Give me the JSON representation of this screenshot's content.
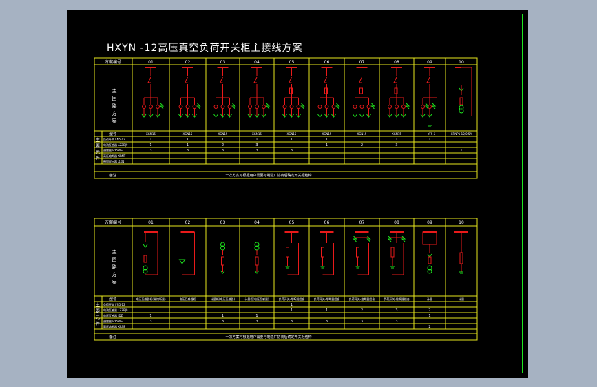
{
  "drawing": {
    "title": "HXYN -12高压真空负荷开关柜主接线方案",
    "colors": {
      "background": "#000000",
      "frame": "#1ee51e",
      "grid": "#e6e61e",
      "busbar": "#e81a1a",
      "device": "#1ee51e",
      "text": "#ffffff"
    }
  },
  "upper_table": {
    "header_label": "方案编号",
    "schemes": [
      "01",
      "02",
      "03",
      "04",
      "05",
      "06",
      "07",
      "08",
      "09",
      "10"
    ],
    "diagram_label": "主回路方案",
    "type_label": "型号",
    "types": [
      "XGN15",
      "XGN15",
      "XGN15",
      "XGN15",
      "XGN15",
      "XGN15",
      "XGN15",
      "XGN15",
      "一 YFS 5",
      "XRNP1-12/0.5A"
    ],
    "components_label": "主要元件",
    "component_rows": [
      {
        "label": "负荷开关 FN5-12",
        "values": [
          "1",
          "1",
          "1",
          "1",
          "1",
          "1",
          "1",
          "1",
          "1",
          ""
        ]
      },
      {
        "label": "电流互感器 LZZBJ9",
        "values": [
          "1",
          "1",
          "2",
          "3",
          "",
          "1",
          "2",
          "3",
          "",
          ""
        ]
      },
      {
        "label": "避雷器 HY5WS",
        "values": [
          "3",
          "3",
          "3",
          "3",
          "3",
          "",
          "",
          "",
          "",
          "1"
        ]
      },
      {
        "label": "高压熔断器 XRNT",
        "values": [
          "",
          "",
          "",
          "",
          "",
          "",
          "",
          "",
          "",
          ""
        ]
      },
      {
        "label": "带电显示器 DXN",
        "values": [
          "",
          "",
          "",
          "",
          "",
          "",
          "",
          "",
          "",
          ""
        ]
      }
    ],
    "note_label": "备注",
    "note": "一次方案可根据用户需要与制造厂协商后确定开关柜结构"
  },
  "lower_table": {
    "header_label": "方案编号",
    "schemes": [
      "01",
      "02",
      "03",
      "04",
      "05",
      "06",
      "07",
      "08",
      "09",
      "10"
    ],
    "diagram_label": "主回路方案",
    "type_label": "型号",
    "types": [
      "电压互感器柜(带熔断器)",
      "电压互感器柜",
      "计量柜(电压互感器)",
      "计量柜(电压互感器)",
      "负荷开关-熔断器组合",
      "负荷开关-熔断器组合",
      "负荷开关-熔断器组合",
      "负荷开关-熔断器组合",
      "计量",
      "计量"
    ],
    "components_label": "主要元件",
    "component_rows": [
      {
        "label": "负荷开关 FN5-12",
        "values": [
          "",
          "",
          "",
          "",
          "1",
          "",
          "",
          "",
          "",
          ""
        ]
      },
      {
        "label": "电流互感器 LZZBJ9",
        "values": [
          "",
          "",
          "",
          "",
          "1",
          "1",
          "2",
          "3",
          "2",
          ""
        ]
      },
      {
        "label": "电压互感器 JDZ",
        "values": [
          "1",
          "",
          "1",
          "1",
          "",
          "",
          "",
          "",
          "1",
          ""
        ]
      },
      {
        "label": "避雷器 HY5WS",
        "values": [
          "3",
          "",
          "3",
          "3",
          "3",
          "3",
          "3",
          "3",
          "",
          ""
        ]
      },
      {
        "label": "高压熔断器 XRNP",
        "values": [
          "",
          "",
          "",
          "",
          "",
          "",
          "",
          "",
          "2",
          ""
        ]
      }
    ],
    "note_label": "备注",
    "note": "一次方案可根据用户需要与制造厂协商后确定开关柜结构"
  }
}
